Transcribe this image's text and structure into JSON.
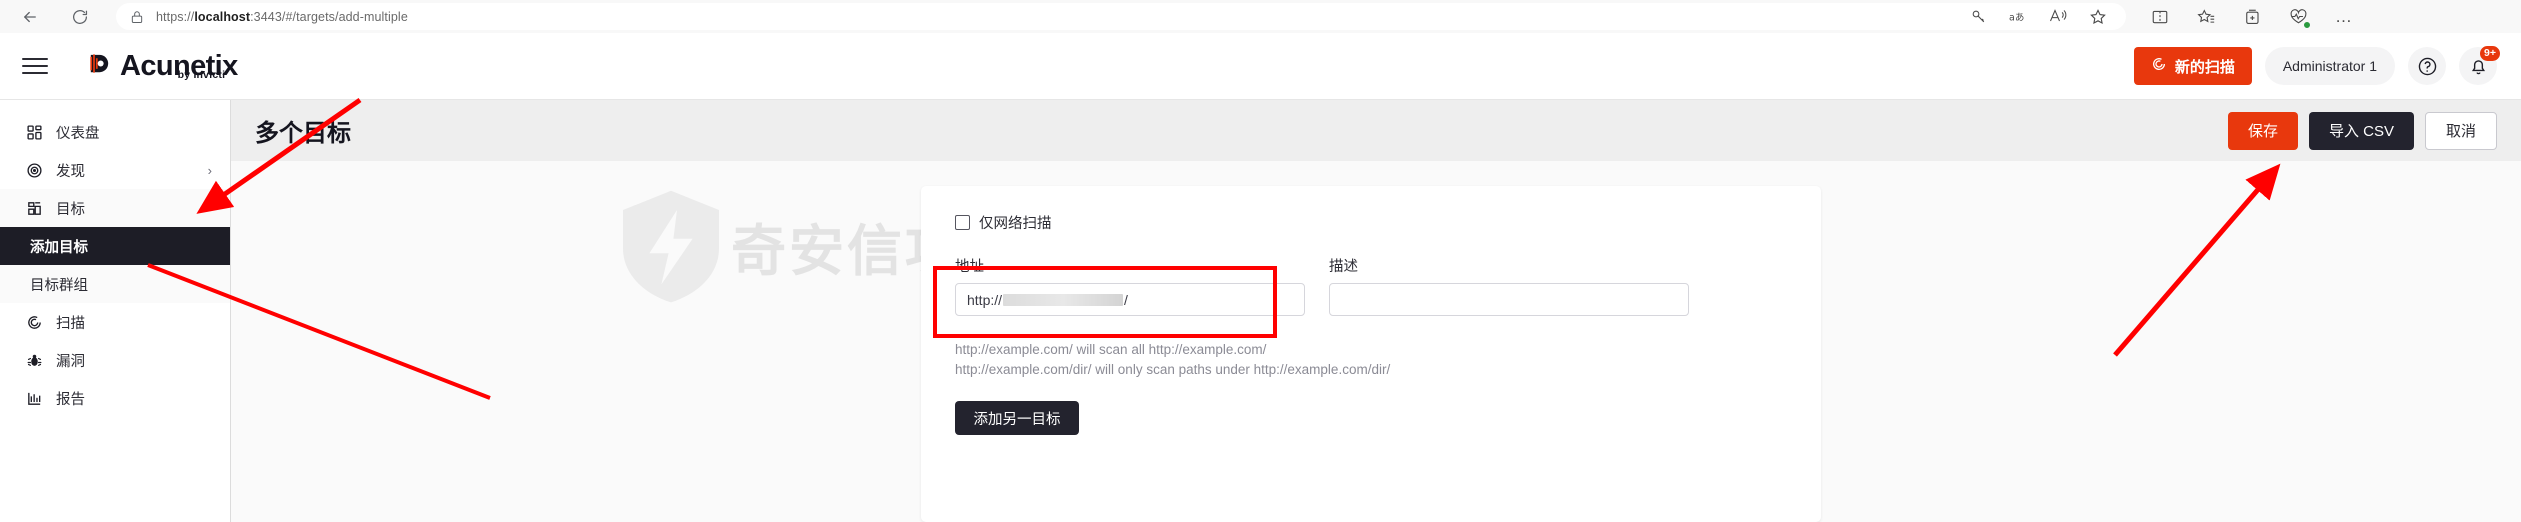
{
  "browser": {
    "back_label": "Back",
    "reload_label": "Reload",
    "url_prefix": "https://",
    "url_host": "localhost",
    "url_rest": ":3443/#/targets/add-multiple",
    "url_full": "https://localhost:3443/#/targets/add-multiple",
    "toolbar_icons": [
      "password-key-icon",
      "translate-icon",
      "read-aloud-icon",
      "favorite-star-icon",
      "split-screen-icon",
      "favorites-list-icon",
      "collections-icon",
      "browser-essentials-icon",
      "settings-more-icon"
    ],
    "more_label": "…"
  },
  "header": {
    "menu_label": "Menu",
    "brand_name": "Acunetix",
    "brand_sub": "by Invicti",
    "new_scan_label": "新的扫描",
    "user_label": "Administrator 1",
    "help_label": "?",
    "notification_badge": "9+"
  },
  "sidebar": {
    "items": [
      {
        "label": "仪表盘",
        "icon": "dashboard-icon",
        "state": "default",
        "chevron": ""
      },
      {
        "label": "发现",
        "icon": "discovery-target-icon",
        "state": "default",
        "chevron": "›"
      },
      {
        "label": "目标",
        "icon": "targets-icon",
        "state": "expanded",
        "chevron": "⌄"
      },
      {
        "label": "添加目标",
        "icon": "",
        "state": "active",
        "chevron": ""
      },
      {
        "label": "目标群组",
        "icon": "",
        "state": "sub",
        "chevron": ""
      },
      {
        "label": "扫描",
        "icon": "scans-icon",
        "state": "default",
        "chevron": ""
      },
      {
        "label": "漏洞",
        "icon": "bug-icon",
        "state": "default",
        "chevron": ""
      },
      {
        "label": "报告",
        "icon": "reports-chart-icon",
        "state": "default",
        "chevron": ""
      }
    ]
  },
  "page": {
    "title": "多个目标",
    "save_label": "保存",
    "import_csv_label": "导入 CSV",
    "cancel_label": "取消"
  },
  "form": {
    "network_only_label": "仅网络扫描",
    "network_only_checked": false,
    "address_label": "地址",
    "address_prefix": "http://",
    "address_suffix": "/",
    "address_redacted": true,
    "description_label": "描述",
    "description_value": "",
    "description_placeholder": "",
    "help_line1": "http://example.com/ will scan all http://example.com/",
    "help_line2": "http://example.com/dir/ will only scan paths under http://example.com/dir/",
    "add_another_label": "添加另一目标"
  },
  "watermark": {
    "text": "奇安信攻防社区"
  },
  "colors": {
    "accent": "#e8380d",
    "dark": "#23232e",
    "page_bg": "#fafafa",
    "titlebar_bg": "#eeeeee",
    "annotation": "#ff0000"
  }
}
